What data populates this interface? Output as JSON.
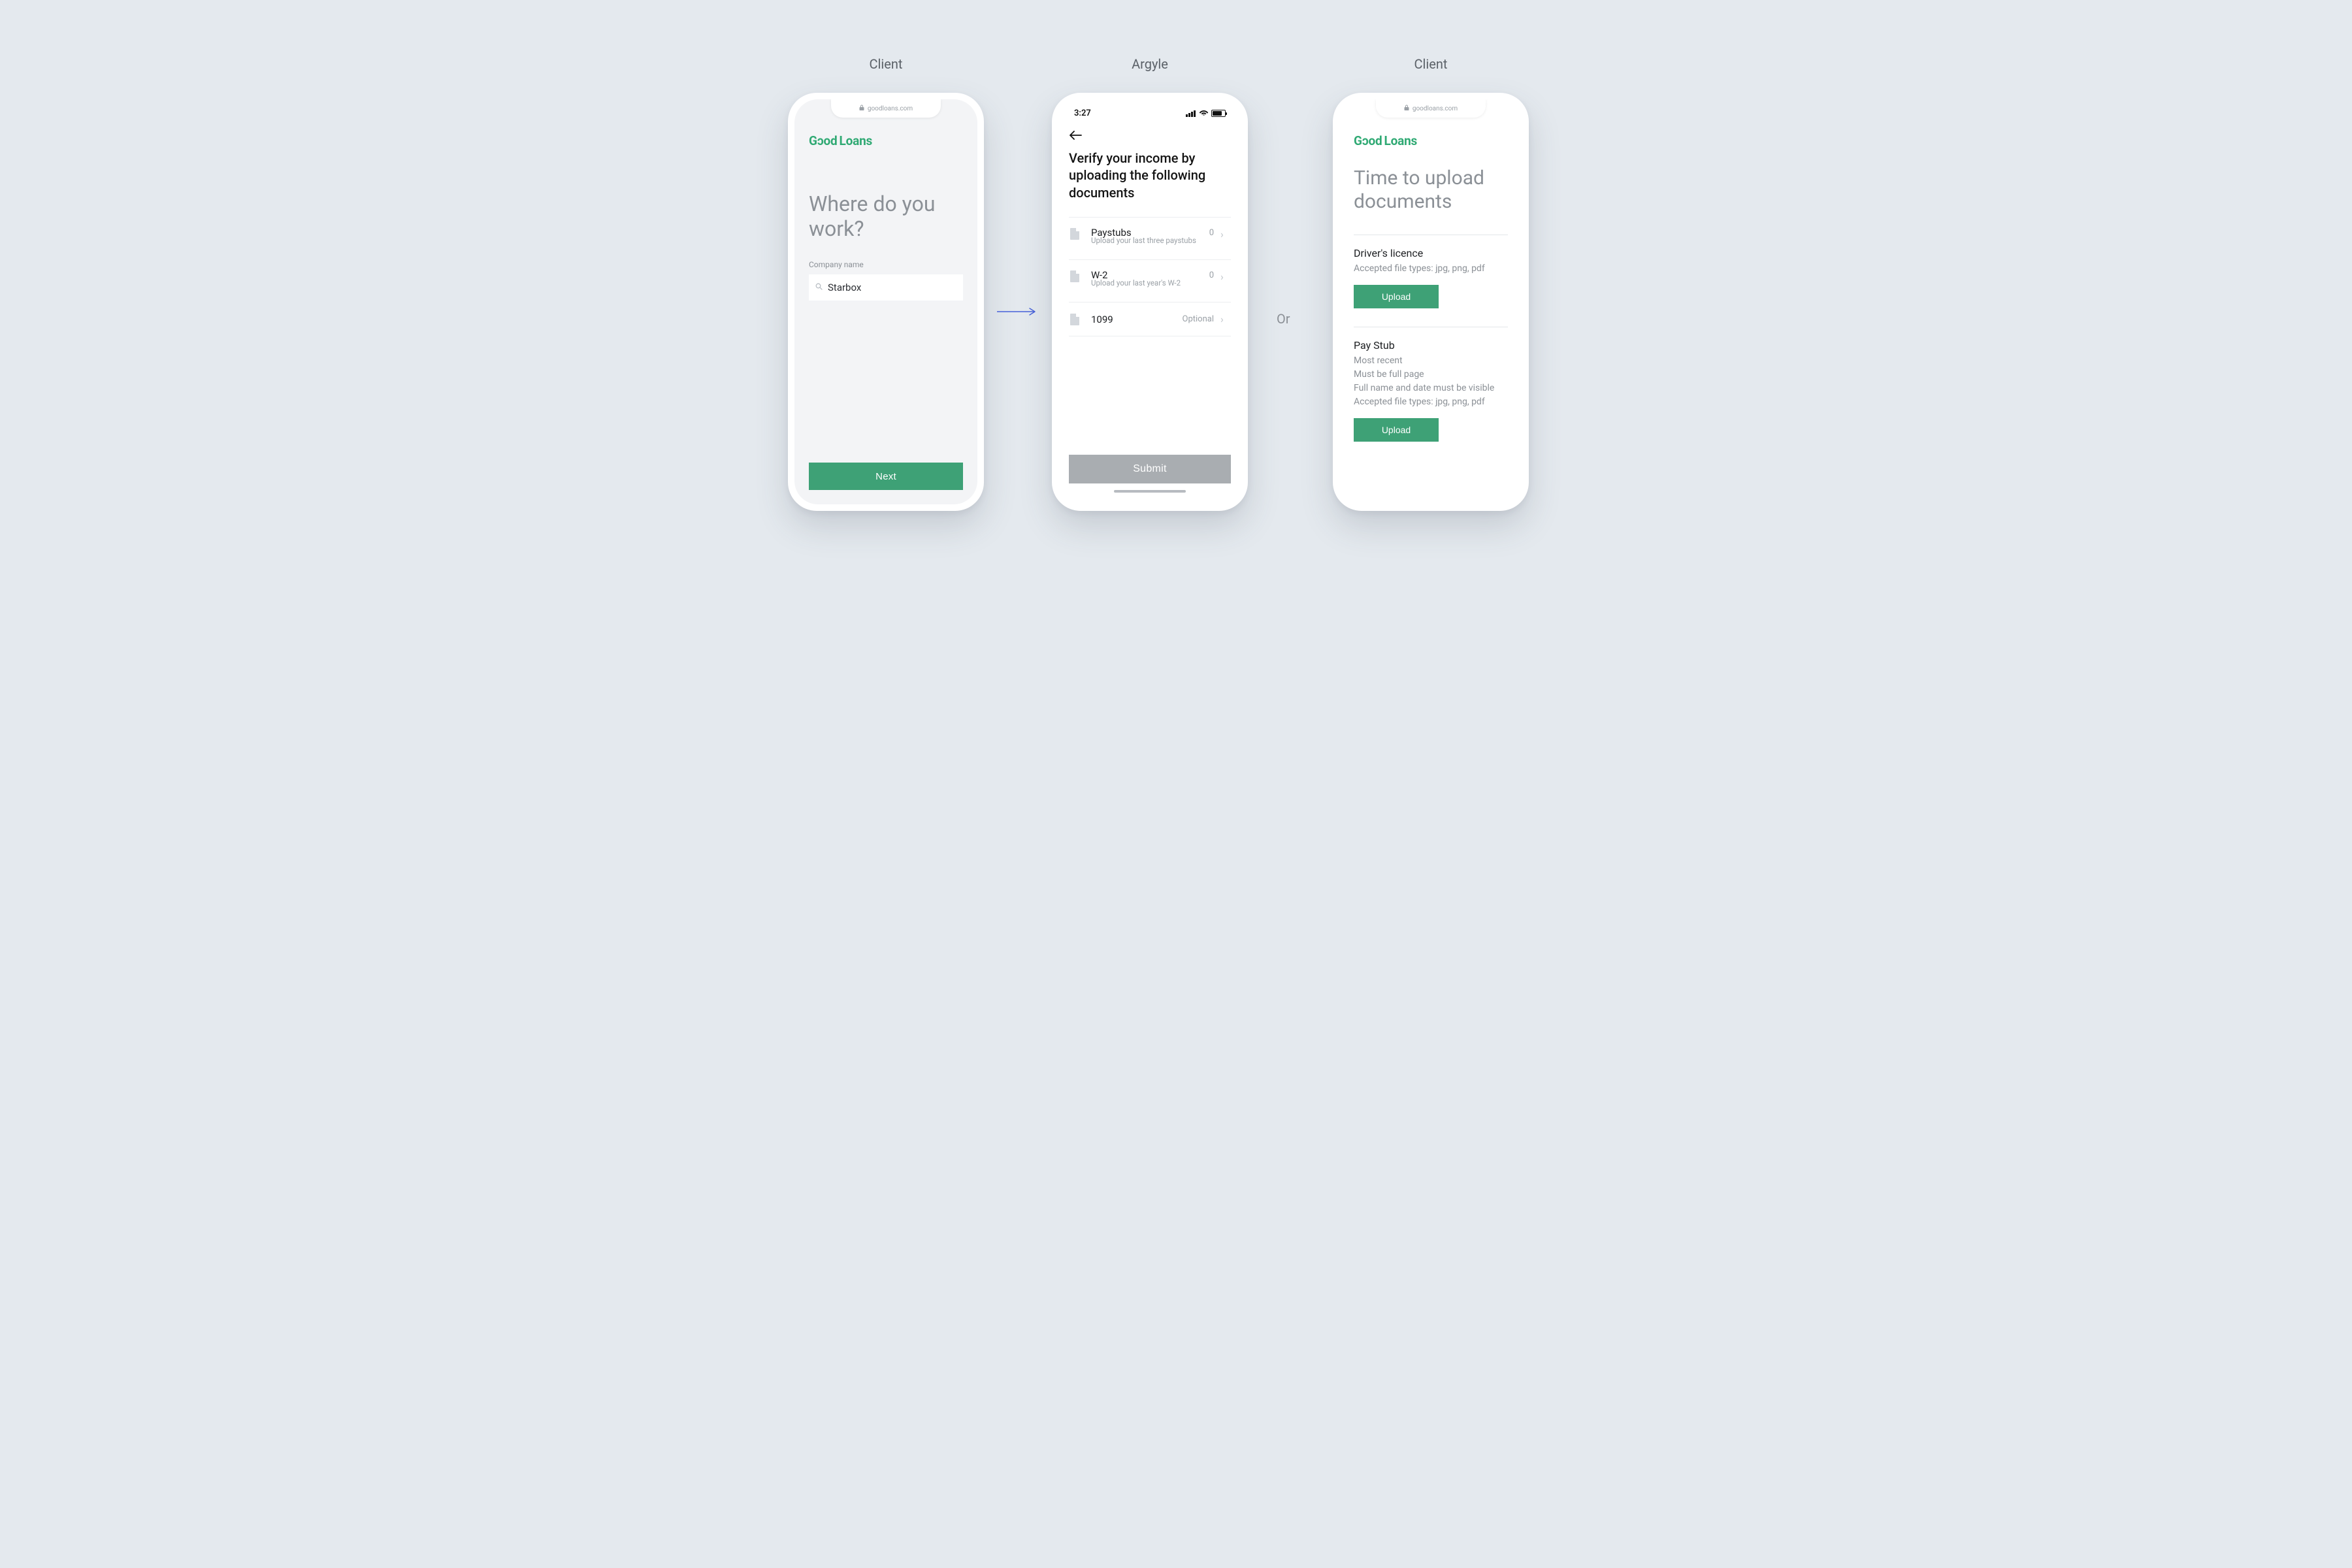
{
  "labels": {
    "col1": "Client",
    "col2": "Argyle",
    "col3": "Client",
    "or": "Or"
  },
  "brand": {
    "part1": "G",
    "part2_flip": "c",
    "part3": "od",
    "gap": "",
    "part4": "Loans"
  },
  "screen1": {
    "url": "goodloans.com",
    "heading": "Where do you work?",
    "field_label": "Company name",
    "field_value": "Starbox",
    "next": "Next"
  },
  "screen2": {
    "time": "3:27",
    "heading": "Verify your income by uploading the following documents",
    "docs": [
      {
        "title": "Paystubs",
        "sub": "Upload your last three paystubs",
        "badge": "0"
      },
      {
        "title": "W-2",
        "sub": "Upload your last year's W-2",
        "badge": "0"
      },
      {
        "title": "1099",
        "sub": "",
        "badge": "Optional"
      }
    ],
    "submit": "Submit"
  },
  "screen3": {
    "url": "goodloans.com",
    "heading": "Time to upload documents",
    "sections": [
      {
        "title": "Driver's licence",
        "lines": [
          "Accepted file types: jpg, png, pdf"
        ],
        "btn": "Upload"
      },
      {
        "title": "Pay Stub",
        "lines": [
          "Most recent",
          "Must be full page",
          "Full name and date must be visible",
          "Accepted file types: jpg, png, pdf"
        ],
        "btn": "Upload"
      }
    ]
  }
}
